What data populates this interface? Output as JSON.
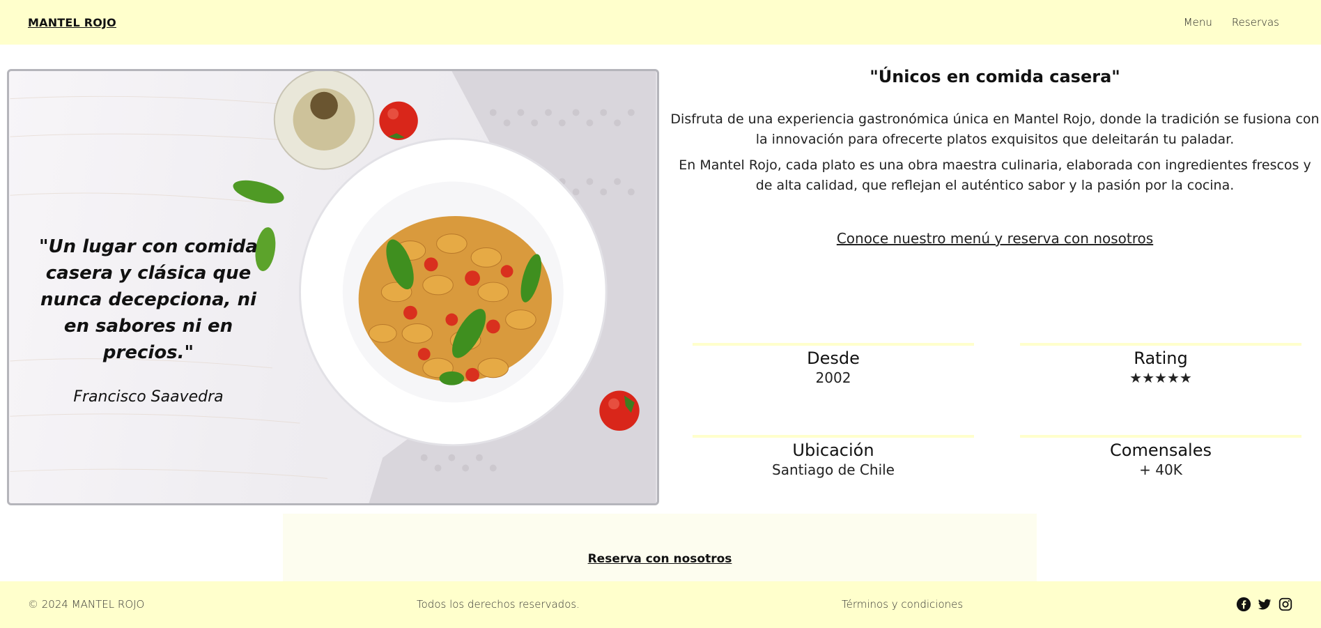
{
  "header": {
    "brand": "MANTEL ROJO",
    "nav": [
      {
        "label": "Menu"
      },
      {
        "label": "Reservas"
      }
    ]
  },
  "hero": {
    "quote": "\"Un lugar con comida casera y clásica que nunca decepciona, ni en sabores ni en precios.\"",
    "author": "Francisco Saavedra"
  },
  "main": {
    "headline": "\"Únicos en comida casera\"",
    "paragraphs": [
      "Disfruta de una experiencia gastronómica única en Mantel Rojo, donde la tradición se fusiona con la innovación para ofrecerte platos exquisitos que deleitarán tu paladar.",
      "En Mantel Rojo, cada plato es una obra maestra culinaria, elaborada con ingredientes frescos y de alta calidad, que reflejan el auténtico sabor y la pasión por la cocina."
    ],
    "cta": "Conoce nuestro menú y reserva con nosotros"
  },
  "stats": [
    {
      "label": "Desde",
      "value": "2002"
    },
    {
      "label": "Rating",
      "value": "★★★★★"
    },
    {
      "label": "Ubicación",
      "value": "Santiago de Chile"
    },
    {
      "label": "Comensales",
      "value": "+ 40K"
    }
  ],
  "reserve": {
    "label": "Reserva con nosotros"
  },
  "footer": {
    "copyright": "© 2024 MANTEL ROJO",
    "rights": "Todos los derechos reservados.",
    "terms": "Términos y condiciones",
    "social_icons": [
      "facebook-icon",
      "twitter-icon",
      "instagram-icon"
    ]
  },
  "colors": {
    "header_bg": "#ffffcc",
    "band_bg": "#fdfdef",
    "frame_border": "#b5b5bb"
  }
}
